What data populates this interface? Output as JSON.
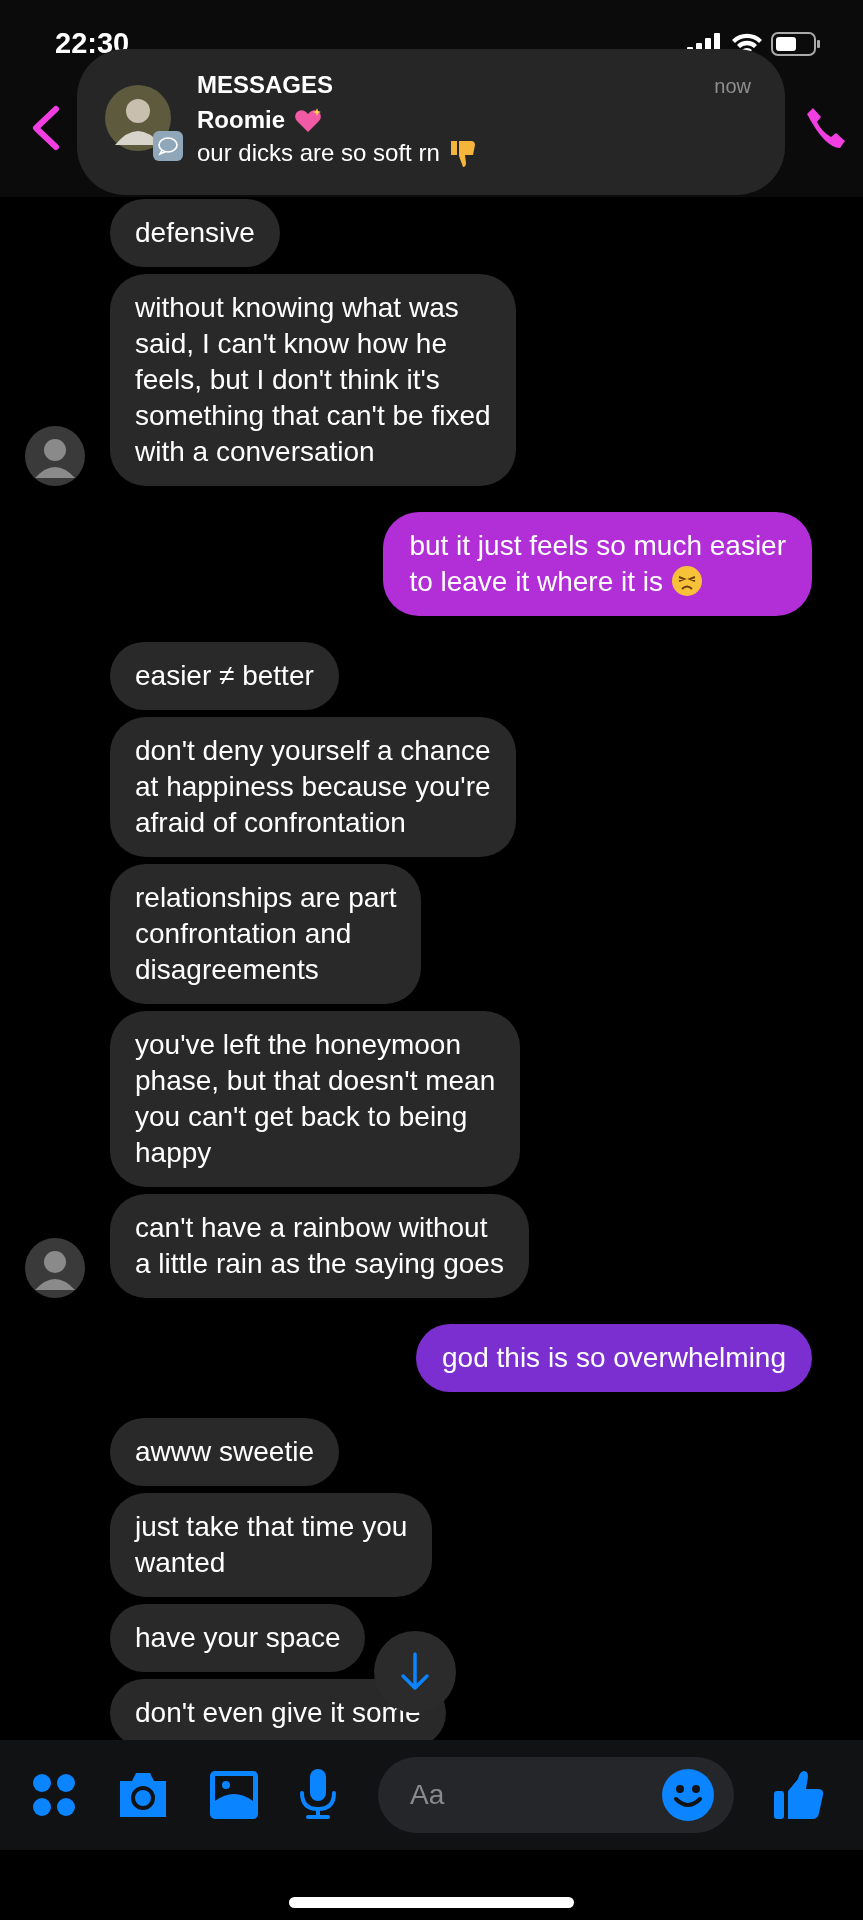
{
  "status_bar": {
    "time": "22:30"
  },
  "notification": {
    "app": "MESSAGES",
    "time": "now",
    "sender": "Roomie",
    "sender_emoji": true,
    "text": "our dicks are so soft rn",
    "text_emoji": true
  },
  "messages": [
    {
      "kind": "received",
      "text": "defensive",
      "avatar": false
    },
    {
      "kind": "received",
      "text": "without knowing what was\nsaid, I can't know how he\nfeels, but I don't think it's\nsomething that can't be fixed\nwith a conversation",
      "avatar": true
    },
    {
      "kind": "sent",
      "text": "but it just feels so much easier\nto leave it where it is",
      "emoji": true,
      "color": "#b22fd8"
    },
    {
      "kind": "received",
      "text": "easier ≠ better",
      "avatar": false
    },
    {
      "kind": "received",
      "text": "don't deny yourself a chance\nat happiness because you're\nafraid of confrontation",
      "avatar": false
    },
    {
      "kind": "received",
      "text": "relationships are part\nconfrontation and\ndisagreements",
      "avatar": false
    },
    {
      "kind": "received",
      "text": "you've left the honeymoon\nphase, but that doesn't mean\nyou can't get back to being\nhappy",
      "avatar": false
    },
    {
      "kind": "received",
      "text": "can't have a rainbow without\na little rain as the saying goes",
      "avatar": true
    },
    {
      "kind": "sent",
      "text": "god this is so overwhelming",
      "emoji": false,
      "color": "#7b2fd0"
    },
    {
      "kind": "received",
      "text": "awww sweetie",
      "avatar": false
    },
    {
      "kind": "received",
      "text": "just take that time you\nwanted",
      "avatar": false
    },
    {
      "kind": "received",
      "text": "have your space",
      "avatar": false
    },
    {
      "kind": "received",
      "text": "don't even give it some",
      "avatar": false
    }
  ],
  "composer": {
    "placeholder": "Aa"
  }
}
